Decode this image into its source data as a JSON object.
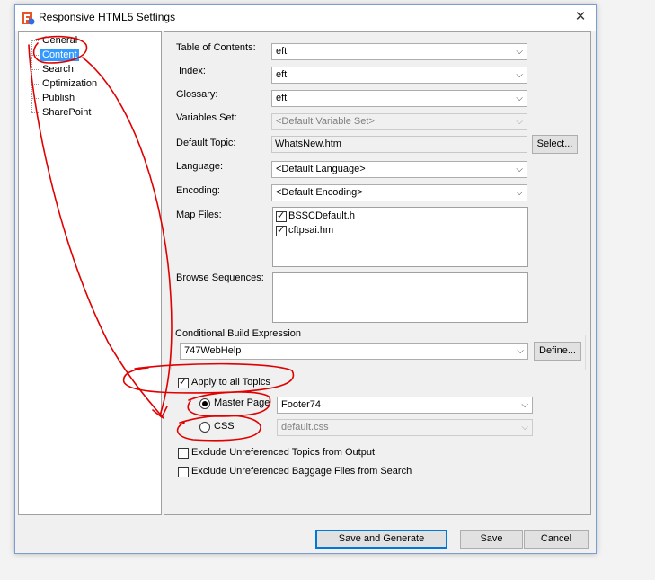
{
  "window": {
    "title": "Responsive HTML5 Settings",
    "close_glyph": "✕"
  },
  "tree": {
    "items": [
      {
        "label": "General"
      },
      {
        "label": "Content"
      },
      {
        "label": "Search"
      },
      {
        "label": "Optimization"
      },
      {
        "label": "Publish"
      },
      {
        "label": "SharePoint"
      }
    ]
  },
  "content": {
    "toc": {
      "label": "Table of Contents:",
      "value": "eft"
    },
    "index": {
      "label": "Index:",
      "value": "eft"
    },
    "glossary": {
      "label": "Glossary:",
      "value": "eft"
    },
    "variables": {
      "label": "Variables Set:",
      "value": "<Default Variable Set>"
    },
    "default_topic": {
      "label": "Default Topic:",
      "value": "WhatsNew.htm",
      "button": "Select..."
    },
    "language": {
      "label": "Language:",
      "value": "<Default Language>"
    },
    "encoding": {
      "label": "Encoding:",
      "value": "<Default Encoding>"
    },
    "map_files": {
      "label": "Map Files:",
      "items": [
        "BSSCDefault.h",
        "cftpsai.hm"
      ]
    },
    "browse_sequences": {
      "label": "Browse Sequences:"
    },
    "conditional": {
      "title": "Conditional Build Expression",
      "value": "747WebHelp",
      "button": "Define..."
    },
    "apply_all": {
      "label": "Apply to all Topics",
      "checked": true
    },
    "master_page": {
      "label": "Master Page",
      "value": "Footer74",
      "selected": true
    },
    "css": {
      "label": "CSS",
      "value": "default.css",
      "selected": false
    },
    "exclude_topics": {
      "label": "Exclude Unreferenced Topics from Output",
      "checked": false
    },
    "exclude_baggage": {
      "label": "Exclude Unreferenced Baggage Files from Search",
      "checked": false
    }
  },
  "footer": {
    "save_generate": "Save and Generate",
    "save": "Save",
    "cancel": "Cancel"
  },
  "colors": {
    "selection": "#3399ff",
    "annotation": "#e00000",
    "default_button_border": "#0078d7"
  }
}
